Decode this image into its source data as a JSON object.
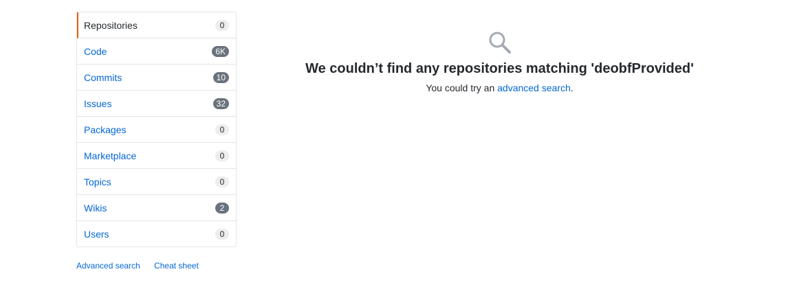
{
  "sidebar": {
    "items": [
      {
        "label": "Repositories",
        "count": "0",
        "selected": true,
        "dark": false
      },
      {
        "label": "Code",
        "count": "6K",
        "selected": false,
        "dark": true
      },
      {
        "label": "Commits",
        "count": "10",
        "selected": false,
        "dark": true
      },
      {
        "label": "Issues",
        "count": "32",
        "selected": false,
        "dark": true
      },
      {
        "label": "Packages",
        "count": "0",
        "selected": false,
        "dark": false
      },
      {
        "label": "Marketplace",
        "count": "0",
        "selected": false,
        "dark": false
      },
      {
        "label": "Topics",
        "count": "0",
        "selected": false,
        "dark": false
      },
      {
        "label": "Wikis",
        "count": "2",
        "selected": false,
        "dark": true
      },
      {
        "label": "Users",
        "count": "0",
        "selected": false,
        "dark": false
      }
    ]
  },
  "footer": {
    "advanced_search": "Advanced search",
    "cheat_sheet": "Cheat sheet"
  },
  "blankslate": {
    "title": "We couldn’t find any repositories matching 'deobfProvided'",
    "text_prefix": "You could try an ",
    "link": "advanced search",
    "text_suffix": "."
  },
  "colors": {
    "accent_selected": "#e36209",
    "link": "#0366d6",
    "icon": "#a3aab1"
  }
}
